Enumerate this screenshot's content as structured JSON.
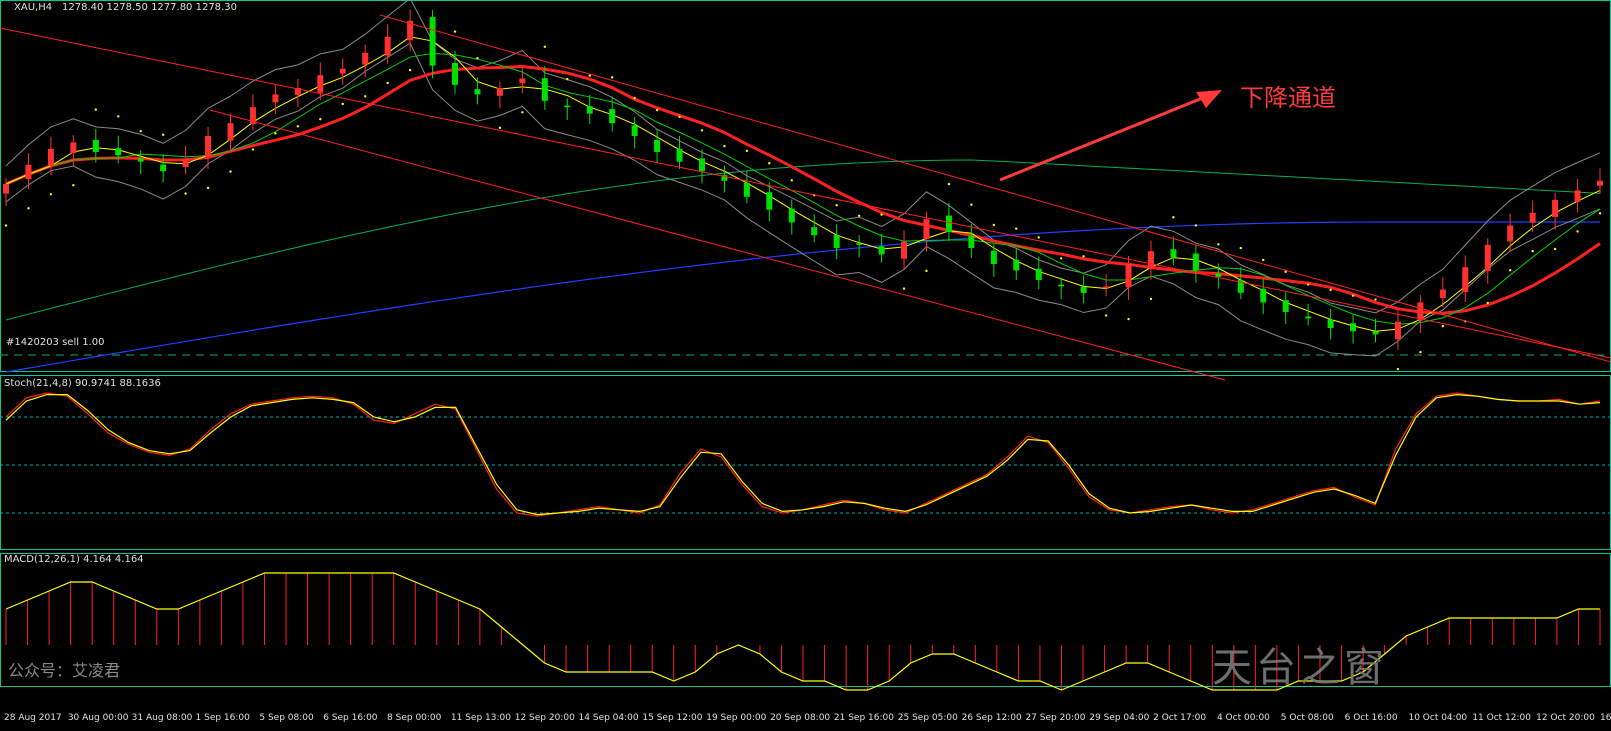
{
  "chart_data": [
    {
      "type": "candlestick",
      "panel": "main",
      "symbol_header": "XAU,H4",
      "ohlc_header": "1278.40 1278.50 1277.80 1278.30",
      "order_label": "#1420203 sell 1.00",
      "annotation": "下降通道",
      "x_tick_labels": [
        "28 Aug 2017",
        "30 Aug 00:00",
        "31 Aug 08:00",
        "1 Sep 16:00",
        "5 Sep 08:00",
        "6 Sep 16:00",
        "8 Sep 00:00",
        "11 Sep 13:00",
        "12 Sep 20:00",
        "14 Sep 04:00",
        "15 Sep 12:00",
        "19 Sep 00:00",
        "20 Sep 08:00",
        "21 Sep 16:00",
        "25 Sep 05:00",
        "26 Sep 12:00",
        "27 Sep 20:00",
        "29 Sep 04:00",
        "2 Oct 17:00",
        "4 Oct 00:00",
        "5 Oct 08:00",
        "6 Oct 16:00",
        "10 Oct 04:00",
        "11 Oct 12:00",
        "12 Oct 20:00",
        "16"
      ],
      "series_trend": {
        "price_close": [
          1305,
          1311,
          1316,
          1318,
          1315,
          1314,
          1312,
          1309,
          1313,
          1320,
          1324,
          1329,
          1333,
          1335,
          1339,
          1341,
          1346,
          1351,
          1356,
          1342,
          1336,
          1333,
          1335,
          1338,
          1331,
          1329,
          1327,
          1324,
          1320,
          1315,
          1312,
          1309,
          1306,
          1301,
          1297,
          1293,
          1289,
          1285,
          1286,
          1283,
          1287,
          1294,
          1290,
          1285,
          1280,
          1278,
          1275,
          1273,
          1271,
          1273,
          1280,
          1284,
          1282,
          1278,
          1276,
          1271,
          1268,
          1265,
          1263,
          1260,
          1259,
          1258,
          1262,
          1268,
          1272,
          1279,
          1286,
          1292,
          1296,
          1300,
          1303,
          1306
        ]
      },
      "colors": {
        "up": "#ff3030",
        "down": "#00e000",
        "channel": "#ff2020",
        "ma_fast": "#ffff00",
        "ma_mid": "#00d000",
        "ma_slow": "#ff2020",
        "ma_200": "#00b050",
        "ma_blue": "#1e40ff",
        "bands": "#8a8a8a",
        "sar": "#ffff00",
        "grid": "#00cc99"
      }
    },
    {
      "type": "line",
      "panel": "stochastic",
      "header": "Stoch(21,4,8) 90.9741 88.1636",
      "levels": [
        80,
        50,
        20
      ],
      "series": [
        {
          "values": [
            80,
            92,
            95,
            93,
            82,
            70,
            63,
            58,
            56,
            60,
            72,
            82,
            88,
            90,
            92,
            93,
            92,
            88,
            78,
            76,
            82,
            88,
            85,
            60,
            35,
            20,
            18,
            20,
            22,
            24,
            22,
            20,
            25,
            45,
            60,
            55,
            38,
            24,
            20,
            22,
            25,
            28,
            26,
            22,
            20,
            26,
            32,
            38,
            44,
            55,
            68,
            64,
            48,
            30,
            22,
            20,
            22,
            24,
            25,
            22,
            20,
            22,
            26,
            30,
            34,
            36,
            30,
            25,
            60,
            82,
            93,
            95,
            93,
            91,
            90,
            90,
            91,
            88,
            90
          ]
        },
        {
          "values": [
            78,
            90,
            94,
            94,
            84,
            72,
            64,
            59,
            57,
            59,
            70,
            80,
            87,
            89,
            91,
            92,
            91,
            89,
            80,
            77,
            80,
            86,
            86,
            62,
            38,
            22,
            19,
            20,
            21,
            23,
            22,
            21,
            24,
            42,
            58,
            57,
            40,
            26,
            21,
            22,
            24,
            27,
            26,
            23,
            21,
            25,
            31,
            37,
            43,
            53,
            66,
            65,
            50,
            32,
            23,
            20,
            21,
            23,
            25,
            23,
            21,
            21,
            25,
            29,
            33,
            35,
            31,
            26,
            56,
            80,
            92,
            94,
            93,
            91,
            90,
            90,
            90,
            88,
            89
          ]
        }
      ]
    },
    {
      "type": "bar",
      "panel": "macd",
      "header": "MACD(12,26,1) 4.164 4.164",
      "values": [
        4,
        5,
        6,
        7,
        7,
        6,
        5,
        4,
        4,
        5,
        6,
        7,
        8,
        8,
        8,
        8,
        8,
        8,
        8,
        7,
        6,
        5,
        4,
        2,
        0,
        -2,
        -3,
        -3,
        -3,
        -3,
        -3,
        -4,
        -3,
        -1,
        0,
        -1,
        -3,
        -4,
        -4,
        -5,
        -5,
        -4,
        -2,
        -1,
        -1,
        -2,
        -3,
        -4,
        -4,
        -5,
        -4,
        -3,
        -2,
        -2,
        -3,
        -4,
        -5,
        -5,
        -5,
        -5,
        -4,
        -4,
        -4,
        -3,
        -1,
        1,
        2,
        3,
        3,
        3,
        3,
        3,
        3,
        4,
        4
      ]
    }
  ],
  "watermark": "公众号：艾凌君",
  "logo_text": "天台之窗"
}
